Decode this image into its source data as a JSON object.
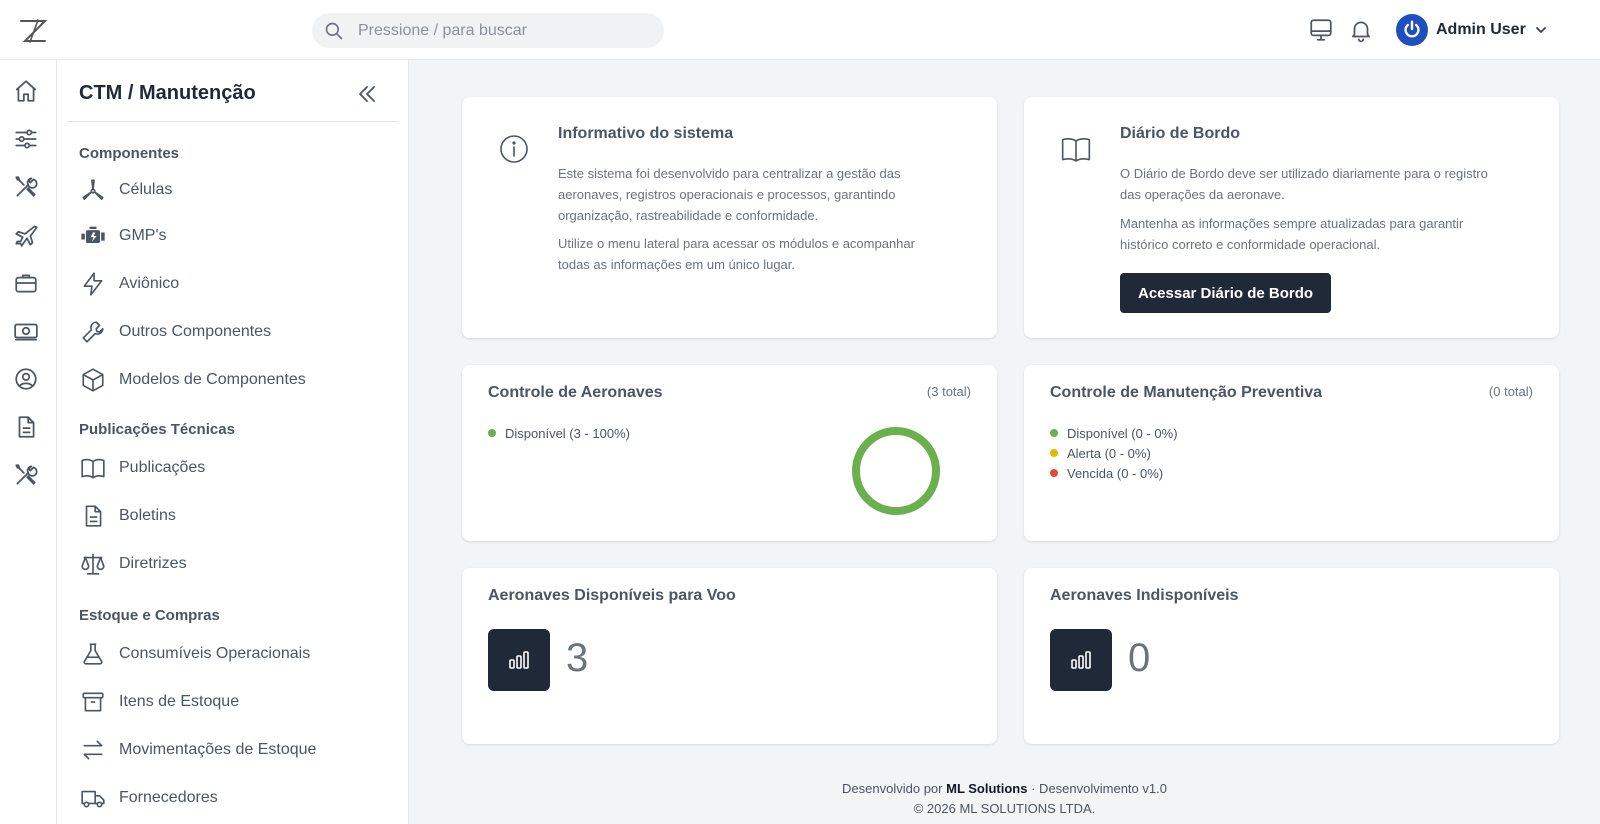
{
  "header": {
    "search_placeholder": "Pressione / para buscar",
    "user_name": "Admin User"
  },
  "sidebar": {
    "title": "CTM / Manutenção",
    "sections": {
      "components": "Componentes",
      "publications": "Publicações Técnicas",
      "stock": "Estoque e Compras"
    },
    "items": [
      {
        "label": "Células",
        "icon": "propeller-icon"
      },
      {
        "label": "GMP's",
        "icon": "engine-icon"
      },
      {
        "label": "Aviônico",
        "icon": "lightning-icon"
      },
      {
        "label": "Outros Componentes",
        "icon": "wrench-icon"
      },
      {
        "label": "Modelos de Componentes",
        "icon": "cube-icon"
      },
      {
        "label": "Publicações",
        "icon": "book-icon"
      },
      {
        "label": "Boletins",
        "icon": "document-icon"
      },
      {
        "label": "Diretrizes",
        "icon": "scale-icon"
      },
      {
        "label": "Consumíveis Operacionais",
        "icon": "flask-icon"
      },
      {
        "label": "Itens de Estoque",
        "icon": "archive-icon"
      },
      {
        "label": "Movimentações de Estoque",
        "icon": "arrows-swap-icon"
      },
      {
        "label": "Fornecedores",
        "icon": "truck-icon"
      }
    ]
  },
  "info_card": {
    "title": "Informativo do sistema",
    "p1": "Este sistema foi desenvolvido para centralizar a gestão das aeronaves, registros operacionais e processos, garantindo organização, rastreabilidade e conformidade.",
    "p2": "Utilize o menu lateral para acessar os módulos e acompanhar todas as informações em um único lugar."
  },
  "logbook_card": {
    "title": "Diário de Bordo",
    "p1": "O Diário de Bordo deve ser utilizado diariamente para o registro das operações da aeronave.",
    "p2": "Mantenha as informações sempre atualizadas para garantir histórico correto e conformidade operacional.",
    "button": "Acessar Diário de Bordo"
  },
  "aircraft_control": {
    "title": "Controle de Aeronaves",
    "total": "(3 total)",
    "legend": [
      {
        "label": "Disponível (3 - 100%)",
        "color": "#6ab04c"
      }
    ]
  },
  "maintenance_control": {
    "title": "Controle de Manutenção Preventiva",
    "total": "(0 total)",
    "legend": [
      {
        "label": "Disponível (0 - 0%)",
        "color": "#6ab04c"
      },
      {
        "label": "Alerta (0 - 0%)",
        "color": "#e6b800"
      },
      {
        "label": "Vencida (0 - 0%)",
        "color": "#e04b3c"
      }
    ]
  },
  "available": {
    "title": "Aeronaves Disponíveis para Voo",
    "value": "3"
  },
  "unavailable": {
    "title": "Aeronaves Indisponíveis",
    "value": "0"
  },
  "footer": {
    "prefix": "Desenvolvido por",
    "company": "ML Solutions",
    "suffix": "· Desenvolvimento v1.0",
    "copyright": "© 2026 ML SOLUTIONS LTDA."
  },
  "chart_data": {
    "type": "pie",
    "categories": [
      "Disponível"
    ],
    "values": [
      3
    ],
    "colors": [
      "#6ab04c"
    ]
  }
}
